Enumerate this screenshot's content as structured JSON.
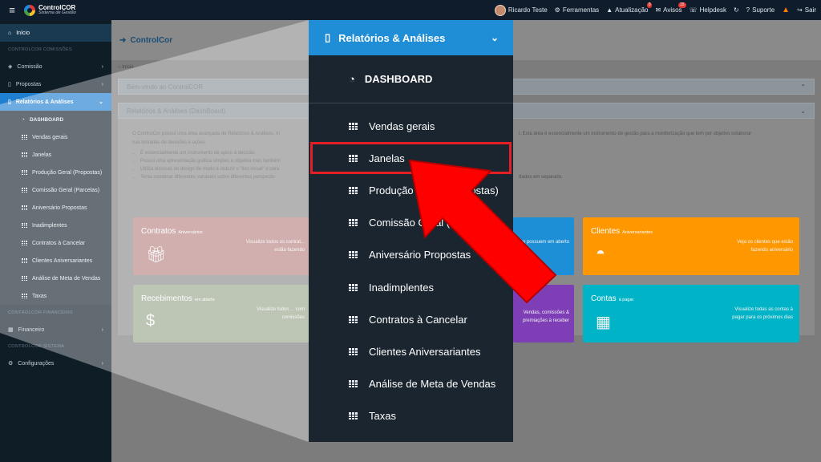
{
  "topbar": {
    "app_name": "ControlCOR",
    "app_sub": "Sistema de Gestão",
    "user": "Ricardo Teste",
    "ferramentas": "Ferramentas",
    "atualizacao": "Atualização",
    "atualizacao_badge": "0",
    "avisos": "Avisos",
    "avisos_badge": "15",
    "helpdesk": "Helpdesk",
    "suporte": "Suporte",
    "sair": "Sair"
  },
  "sidebar": {
    "home": "Início",
    "section_comissoes": "CONTROLCOR COMISSÕES",
    "comissao": "Comissão",
    "propostas": "Propostas",
    "relatorios": "Relatórios & Análises",
    "sub": {
      "dashboard": "DASHBOARD",
      "items": [
        "Vendas gerais",
        "Janelas",
        "Produção Geral (Propostas)",
        "Comissão Geral (Parcelas)",
        "Aniversário Propostas",
        "Inadimplentes",
        "Contratos à Cancelar",
        "Clientes Aniversariantes",
        "Análise de Meta de Vendas",
        "Taxas"
      ]
    },
    "section_financeiro": "CONTROLCOR FINANCEIRO",
    "financeiro": "Financeiro",
    "section_sistema": "CONTROLCOR SISTEMA",
    "configuracoes": "Configurações"
  },
  "main": {
    "header": "ControlCor",
    "breadcrumb": "Início",
    "panel_welcome": "Bem-vindo ao ControlCOR",
    "panel_reports": "Relatórios & Análises (DashBoard)",
    "intro_left": "O ControlCor possui uma área avançada de Relatórios & Análises, m",
    "intro_left2": "nas tomadas de decisões e ações.",
    "intro_right": "l. Esta área é essencialmente um instrumento de gestão para a monitorização que tem por objetivo colaborar",
    "bullets": [
      "É essencialmente um instrumento de apoio à decisão.",
      "Possui uma apresentação gráfica simples e objetiva mas também",
      "Utiliza técnicas de design de modo a reduzir o \"lixo visual\" e para",
      "Tenta combinar diferentes variáveis sobre diferentes perspectiv"
    ],
    "bullet_tail": "dados em separado.",
    "tiles": {
      "contratos_title": "Contratos",
      "contratos_sub": "Aniversários",
      "contratos_desc": "Visualize todos os contrat... estão fazendo",
      "receb_title": "Recebimentos",
      "receb_sub": "em aberto",
      "receb_desc": "Visualize todos ... com comissões",
      "blue_desc": "que possuem em aberto",
      "purple_desc": "Vendas, comissões & premiações à receber",
      "clientes_title": "Clientes",
      "clientes_sub": "Aniversariantes",
      "clientes_desc": "Veja os clientes que estão fazendo aniversário",
      "contas_title": "Contas",
      "contas_sub": "à pagar",
      "contas_desc": "Visualize todas as contas à pagar para os próximos dias"
    }
  },
  "zoom": {
    "header": "Relatórios & Análises",
    "dashboard": "DASHBOARD",
    "items": [
      "Vendas gerais",
      "Janelas",
      "Produção Geral (Propostas)",
      "Comissão Geral (Parcelas)",
      "Aniversário Propostas",
      "Inadimplentes",
      "Contratos à Cancelar",
      "Clientes Aniversariantes",
      "Análise de Meta de Vendas",
      "Taxas"
    ],
    "highlighted": "Janelas"
  },
  "colors": {
    "accent": "#1f8ed7",
    "highlight": "#e31e24",
    "arrow": "#ff0000"
  }
}
